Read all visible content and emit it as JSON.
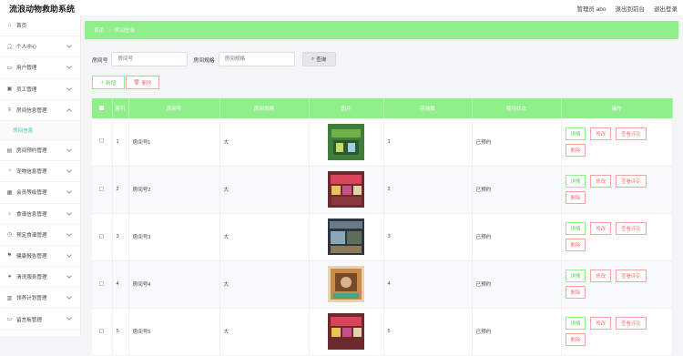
{
  "app": {
    "title": "流浪动物救助系统"
  },
  "topnav": {
    "user": "管理员 abo",
    "front": "退出到前台",
    "logout": "退出登录"
  },
  "sidebar": {
    "items": [
      {
        "label": "首页",
        "icon": "home-icon",
        "has_chevron": false
      },
      {
        "label": "个人中心",
        "icon": "user-icon",
        "has_chevron": true
      },
      {
        "label": "用户管理",
        "icon": "users-icon",
        "has_chevron": true
      },
      {
        "label": "员工管理",
        "icon": "staff-icon",
        "has_chevron": true
      },
      {
        "label": "房间信息管理",
        "icon": "list-icon",
        "has_chevron": true
      },
      {
        "label": "房间信息",
        "icon": "",
        "sub": true
      },
      {
        "label": "房间预约管理",
        "icon": "calendar-icon",
        "has_chevron": true
      },
      {
        "label": "宠物信息管理",
        "icon": "pet-icon",
        "has_chevron": true
      },
      {
        "label": "会员等级管理",
        "icon": "grid-icon",
        "has_chevron": true
      },
      {
        "label": "食谱信息管理",
        "icon": "mic-icon",
        "has_chevron": true
      },
      {
        "label": "预定食谱管理",
        "icon": "clock-icon",
        "has_chevron": true
      },
      {
        "label": "健康报告管理",
        "icon": "flag-icon",
        "has_chevron": true
      },
      {
        "label": "清洗服务管理",
        "icon": "pin-icon",
        "has_chevron": true
      },
      {
        "label": "领养计划管理",
        "icon": "doc-icon",
        "has_chevron": true
      },
      {
        "label": "留言板管理",
        "icon": "board-icon",
        "has_chevron": true
      }
    ]
  },
  "breadcrumb": {
    "home": "首页",
    "sep": "→",
    "current": "房间信息"
  },
  "search": {
    "field1_label": "房间号",
    "field1_placeholder": "房间号",
    "field2_label": "房间规格",
    "field2_placeholder": "房间规格",
    "button": "查询"
  },
  "actions": {
    "add": "新增",
    "delete": "删除"
  },
  "table": {
    "headers": [
      "索引",
      "房间号",
      "房间规格",
      "图片",
      "容纳数",
      "使用状态",
      "操作"
    ],
    "rows": [
      {
        "index": "1",
        "room": "房间号1",
        "spec": "大",
        "capacity": "1",
        "status": "已预约"
      },
      {
        "index": "2",
        "room": "房间号2",
        "spec": "大",
        "capacity": "2",
        "status": "已预约"
      },
      {
        "index": "3",
        "room": "房间号3",
        "spec": "大",
        "capacity": "3",
        "status": "已预约"
      },
      {
        "index": "4",
        "room": "房间号4",
        "spec": "大",
        "capacity": "4",
        "status": "已预约"
      },
      {
        "index": "5",
        "room": "房间号5",
        "spec": "大",
        "capacity": "5",
        "status": "已预约"
      }
    ],
    "ops": {
      "detail": "详情",
      "edit": "修改",
      "review": "查看评论",
      "delete": "删除"
    }
  },
  "colors": {
    "accent": "#8fef8b",
    "danger": "#f07878",
    "sub_active": "#47c6b6"
  }
}
